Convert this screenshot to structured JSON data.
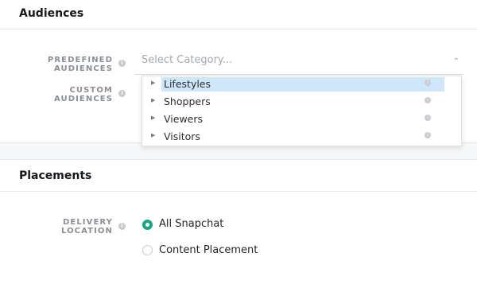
{
  "audiences": {
    "title": "Audiences",
    "predefined_label_line1": "PREDEFINED",
    "predefined_label_line2": "AUDIENCES",
    "custom_label_line1": "CUSTOM",
    "custom_label_line2": "AUDIENCES",
    "select_placeholder": "Select Category...",
    "dropdown_items": [
      {
        "label": "Lifestyles",
        "highlighted": true
      },
      {
        "label": "Shoppers",
        "highlighted": false
      },
      {
        "label": "Viewers",
        "highlighted": false
      },
      {
        "label": "Visitors",
        "highlighted": false
      }
    ]
  },
  "placements": {
    "title": "Placements",
    "delivery_label_line1": "DELIVERY",
    "delivery_label_line2": "LOCATION",
    "options": [
      {
        "label": "All Snapchat",
        "selected": true
      },
      {
        "label": "Content Placement",
        "selected": false
      }
    ]
  },
  "colors": {
    "accent": "#1aa583",
    "highlight": "#cfe6f8"
  },
  "icons": {
    "info": "info-icon",
    "caret": "chevron-up-icon",
    "expand": "triangle-right-icon"
  }
}
